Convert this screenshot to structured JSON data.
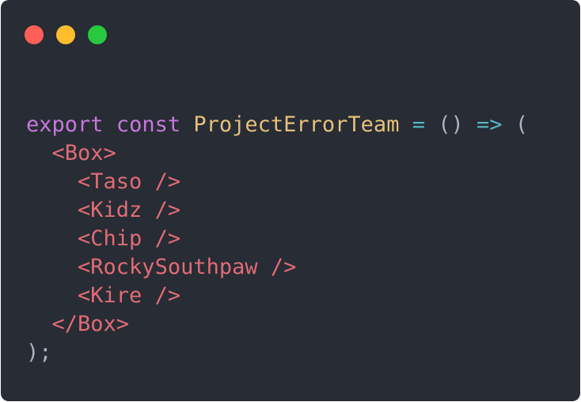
{
  "window": {
    "traffic_lights": [
      {
        "name": "close",
        "color": "#ff5f56"
      },
      {
        "name": "minimize",
        "color": "#ffbd2e"
      },
      {
        "name": "maximize",
        "color": "#27c93f"
      }
    ]
  },
  "colors": {
    "background": "#282c34",
    "keyword": "#c678dd",
    "function_name": "#e5c07b",
    "operator": "#56b6c2",
    "punctuation": "#abb2bf",
    "tag": "#e06c75"
  },
  "code": {
    "line1": {
      "export_kw": "export",
      "const_kw": "const",
      "name": "ProjectErrorTeam",
      "equals": "=",
      "parens": "()",
      "arrow": "=>",
      "open_paren": "("
    },
    "lines": [
      {
        "indent": "  ",
        "text": "<Box>"
      },
      {
        "indent": "    ",
        "text": "<Taso />"
      },
      {
        "indent": "    ",
        "text": "<Kidz />"
      },
      {
        "indent": "    ",
        "text": "<Chip />"
      },
      {
        "indent": "    ",
        "text": "<RockySouthpaw />"
      },
      {
        "indent": "    ",
        "text": "<Kire />"
      },
      {
        "indent": "  ",
        "text": "</Box>"
      }
    ],
    "closing": ");"
  }
}
